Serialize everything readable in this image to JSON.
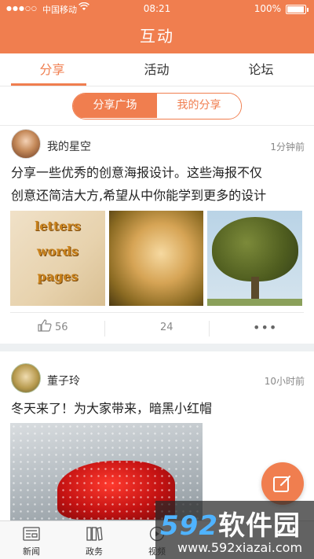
{
  "status_bar": {
    "signal": "●●●○○",
    "carrier": "中国移动",
    "wifi": "wifi-icon",
    "time": "08:21",
    "battery": "100%"
  },
  "header": {
    "title": "互动"
  },
  "tabs": [
    {
      "label": "分享",
      "active": true
    },
    {
      "label": "活动",
      "active": false
    },
    {
      "label": "论坛",
      "active": false
    }
  ],
  "segment": {
    "active": "分享广场",
    "inactive": "我的分享"
  },
  "posts": [
    {
      "author": "我的星空",
      "time": "1分钟前",
      "text_line1": "分享一些优秀的创意海报设计。这些海报不仅",
      "text_line2": "创意还简洁大方,希望从中你能学到更多的设计",
      "images": [
        "letters-words-pages-poster",
        "woman-portrait-poster",
        "tree-poster"
      ],
      "image1_words": [
        "letters",
        "words",
        "pages"
      ],
      "likes": "56",
      "comments": "24",
      "more": "•••"
    },
    {
      "author": "董子玲",
      "time": "10小时前",
      "text": "冬天来了！为大家带来，暗黑小红帽",
      "images": [
        "red-riding-hood-snow-photo"
      ]
    }
  ],
  "bottom_nav": [
    {
      "label": "新闻",
      "icon": "news-icon"
    },
    {
      "label": "政务",
      "icon": "books-icon"
    },
    {
      "label": "视频",
      "icon": "video-icon"
    },
    {
      "label": "",
      "icon": "interact-icon"
    },
    {
      "label": "",
      "icon": "user-icon"
    }
  ],
  "watermark": {
    "brand_num": "592",
    "brand_cn": "软件园",
    "url": "www.592xiazai.com"
  },
  "colors": {
    "accent": "#f07e4f",
    "text": "#222222",
    "muted": "#888888",
    "divider": "#edf0f2"
  }
}
